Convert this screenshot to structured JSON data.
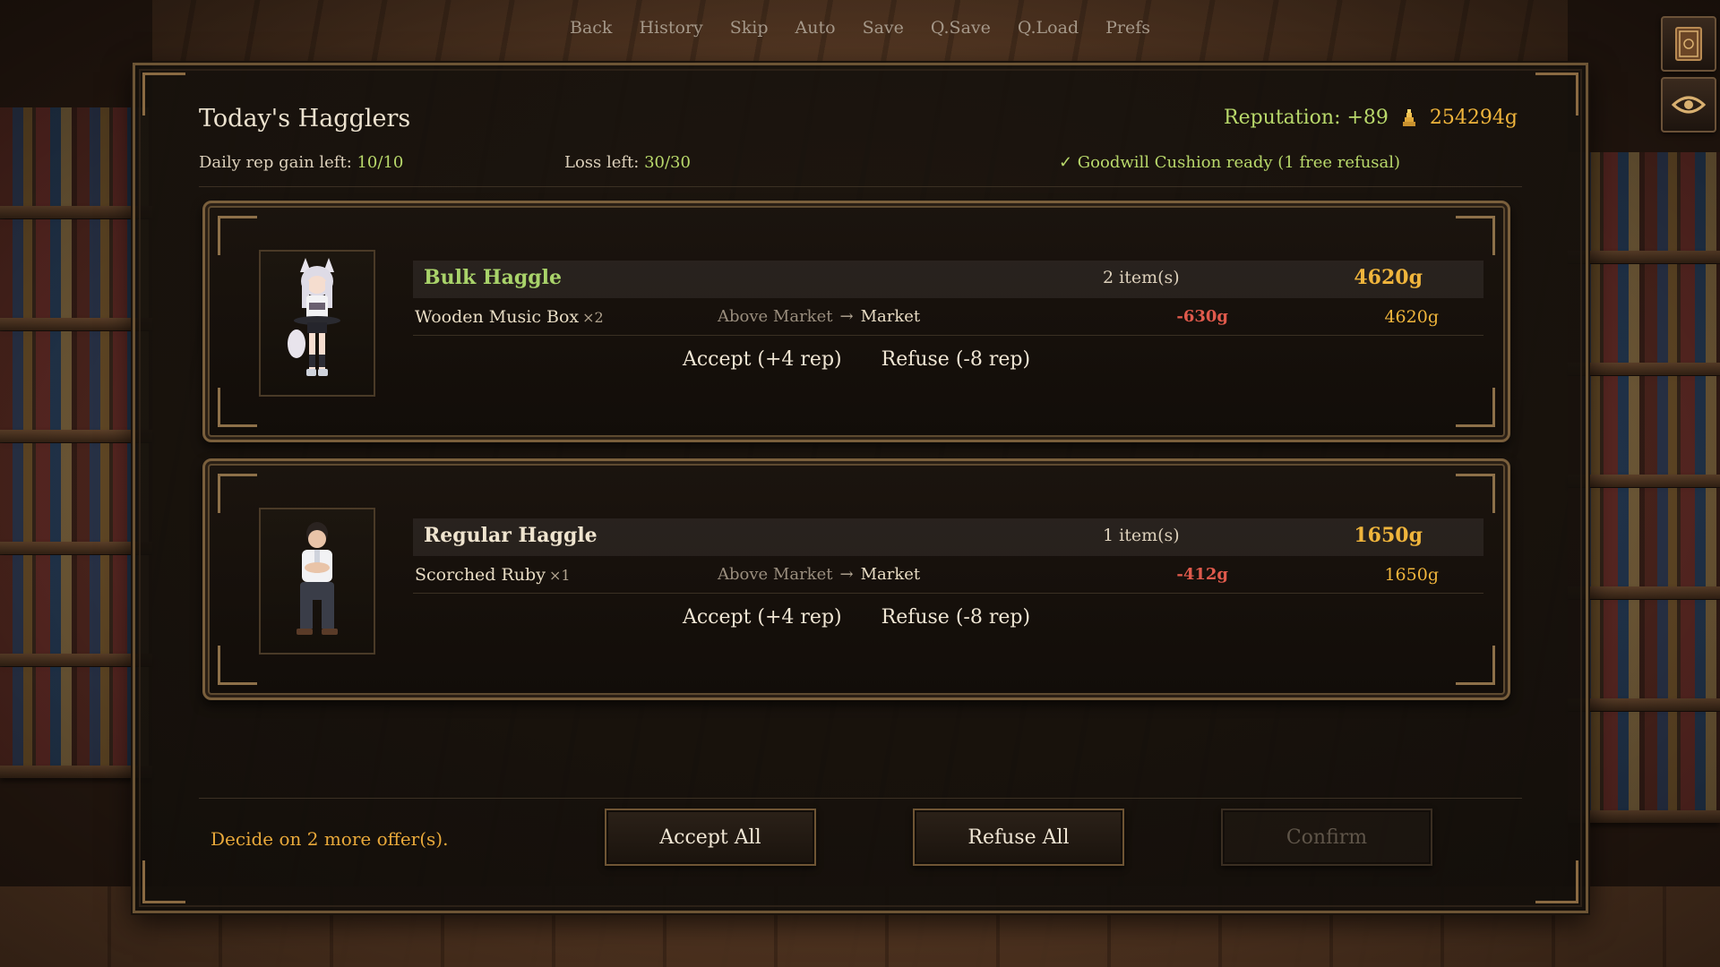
{
  "quick_menu": [
    "Back",
    "History",
    "Skip",
    "Auto",
    "Save",
    "Q.Save",
    "Q.Load",
    "Prefs"
  ],
  "side_buttons": {
    "top": "journal-book-icon",
    "bottom": "eye-icon"
  },
  "panel": {
    "title": "Today's Hagglers",
    "reputation": "Reputation: +89",
    "gold": "254294g",
    "daily_rep_label": "Daily rep gain left: ",
    "daily_rep_value": "10/10",
    "loss_label": "Loss left: ",
    "loss_value": "30/30",
    "goodwill": "✓ Goodwill Cushion ready (1 free refusal)"
  },
  "offers": [
    {
      "type": "Bulk Haggle",
      "count": "2 item(s)",
      "total": "4620g",
      "item": {
        "name": "Wooden Music Box",
        "qty": "×2",
        "from": "Above Market",
        "arrow": "→",
        "to": "Market",
        "delta": "-630g",
        "price": "4620g"
      },
      "accept": "Accept (+4 rep)",
      "refuse": "Refuse (-8 rep)"
    },
    {
      "type": "Regular Haggle",
      "count": "1 item(s)",
      "total": "1650g",
      "item": {
        "name": "Scorched Ruby",
        "qty": "×1",
        "from": "Above Market",
        "arrow": "→",
        "to": "Market",
        "delta": "-412g",
        "price": "1650g"
      },
      "accept": "Accept (+4 rep)",
      "refuse": "Refuse (-8 rep)"
    }
  ],
  "footer": {
    "message": "Decide on 2 more offer(s).",
    "accept_all": "Accept All",
    "refuse_all": "Refuse All",
    "confirm": "Confirm"
  },
  "colors": {
    "accent_green": "#b9d96b",
    "gold": "#f0b53c",
    "negative": "#e05a4c",
    "frame": "#7a5f3c"
  }
}
